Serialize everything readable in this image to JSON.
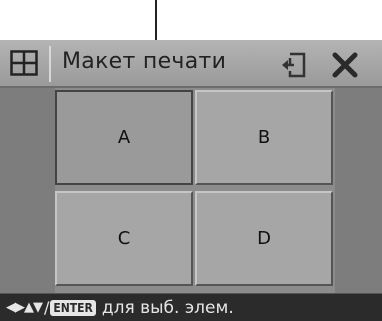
{
  "title": "Макет печати",
  "cells": [
    {
      "label": "A",
      "selected": true
    },
    {
      "label": "B",
      "selected": false
    },
    {
      "label": "C",
      "selected": false
    },
    {
      "label": "D",
      "selected": false
    }
  ],
  "status": {
    "arrows": "◀▶▲▼",
    "slash": "/",
    "enter": "ENTER",
    "text": "для выб. элем."
  },
  "icons": {
    "layout": "layout-grid-icon",
    "return": "return-icon",
    "close": "close-icon"
  }
}
